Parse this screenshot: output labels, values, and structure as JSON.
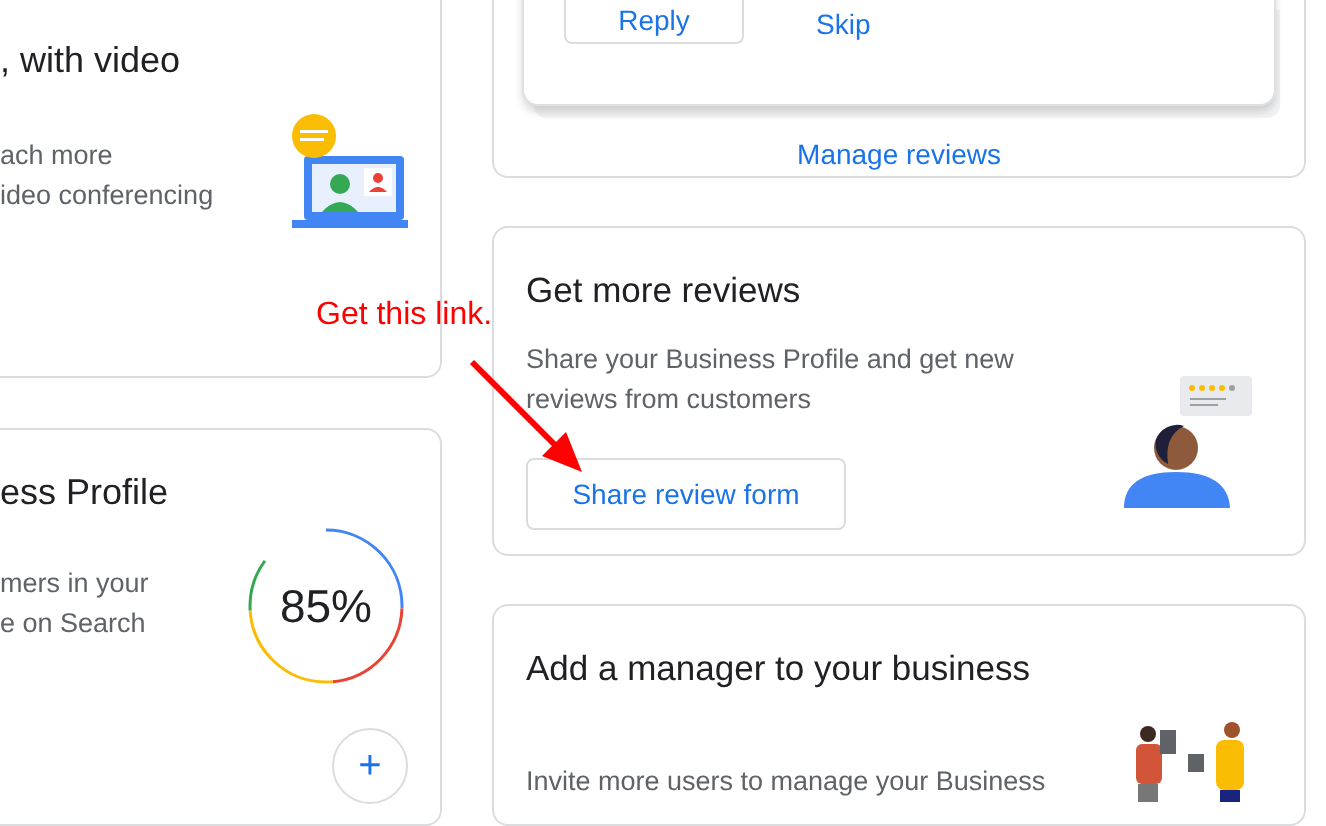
{
  "left_cards": [
    {
      "kind": "video",
      "title": ", with video",
      "description": [
        "ach more",
        "ideo conferencing"
      ]
    },
    {
      "kind": "profile",
      "title": "ess Profile",
      "description": [
        "mers in your",
        "e on Search"
      ],
      "progress": {
        "level": 0.85,
        "reading": "85%"
      },
      "add_button": "+"
    }
  ],
  "reviews_card": {
    "buttons": [
      "Reply",
      "Skip"
    ],
    "link": "Manage reviews"
  },
  "get_reviews_card": {
    "title": "Get more reviews",
    "description": "Share your Business Profile and get new reviews from customers",
    "button": "Share review form"
  },
  "manager_card": {
    "title": "Add a manager to your business",
    "description": "Invite more users to manage your Business"
  },
  "annotation": {
    "text": "Get this link."
  }
}
